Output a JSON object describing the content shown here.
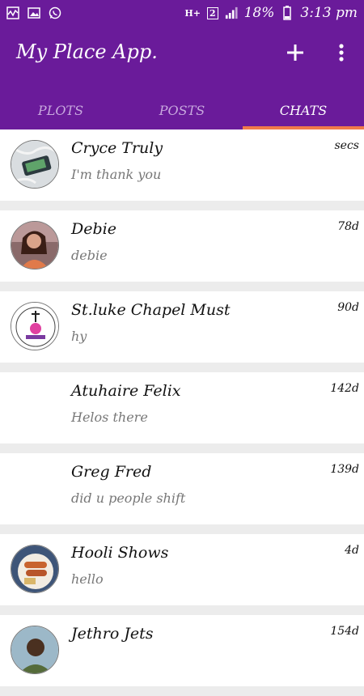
{
  "status_bar": {
    "network": "H+",
    "sim": "2",
    "battery": "18%",
    "time": "3:13 pm"
  },
  "app": {
    "title": "My Place App."
  },
  "tabs": [
    {
      "label": "PLOTS",
      "active": false
    },
    {
      "label": "POSTS",
      "active": false
    },
    {
      "label": "CHATS",
      "active": true
    }
  ],
  "chats": [
    {
      "name": "Cryce Truly",
      "message": "I'm thank you",
      "time": "secs",
      "avatar": "earphones-photo"
    },
    {
      "name": "Debie",
      "message": "debie",
      "time": "78d",
      "avatar": "woman-photo"
    },
    {
      "name": "St.luke Chapel Must",
      "message": "hy",
      "time": "90d",
      "avatar": "chapel-logo"
    },
    {
      "name": "Atuhaire Felix",
      "message": "Helos there",
      "time": "142d",
      "avatar": "none"
    },
    {
      "name": "Greg Fred",
      "message": "did u people shift",
      "time": "139d",
      "avatar": "none"
    },
    {
      "name": "Hooli Shows",
      "message": "hello",
      "time": "4d",
      "avatar": "food-photo"
    },
    {
      "name": "Jethro Jets",
      "message": "",
      "time": "154d",
      "avatar": "man-photo"
    }
  ],
  "colors": {
    "primary": "#6a1b9a",
    "tab_indicator": "#f07a4a",
    "background": "#ececec"
  }
}
